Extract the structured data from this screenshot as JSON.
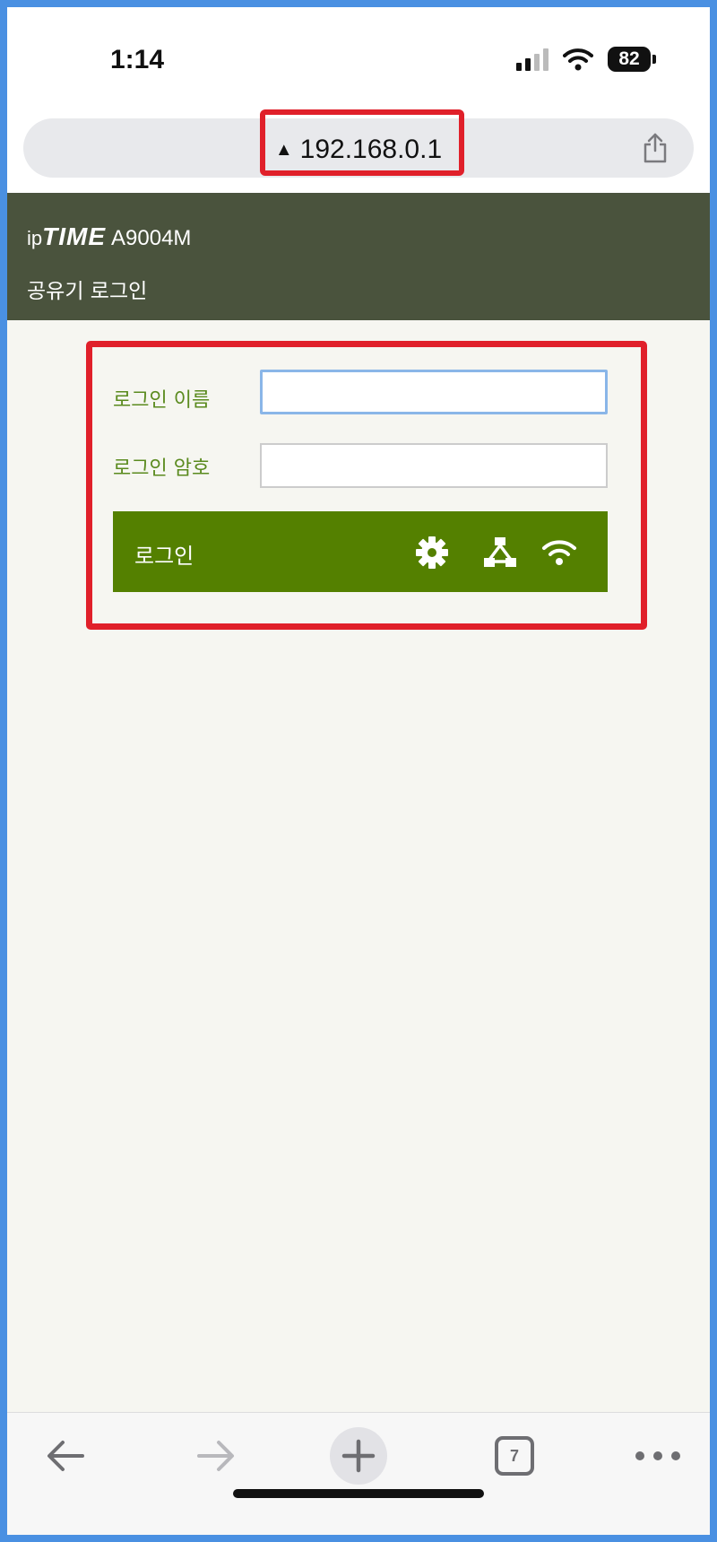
{
  "status_bar": {
    "time": "1:14",
    "battery": "82"
  },
  "browser": {
    "url": "192.168.0.1",
    "warning_symbol": "▲",
    "open_tabs": "7"
  },
  "router": {
    "brand_prefix": "ip",
    "brand_name": "TIME",
    "model": "A9004M",
    "subtitle": "공유기 로그인"
  },
  "login_form": {
    "username_label": "로그인 이름",
    "username_value": "",
    "password_label": "로그인 암호",
    "password_value": "",
    "submit_label": "로그인",
    "icons": [
      "gear-icon",
      "network-icon",
      "wifi-icon"
    ]
  },
  "toolbar": {
    "icons": [
      "back-arrow-icon",
      "forward-arrow-icon",
      "new-tab-plus-icon",
      "tabs-icon",
      "more-icon"
    ]
  },
  "colors": {
    "header_bg": "#4a533d",
    "accent_green": "#548000",
    "label_green": "#5a8a1e",
    "highlight_red": "#e0202a",
    "page_bg": "#f6f6f1"
  }
}
